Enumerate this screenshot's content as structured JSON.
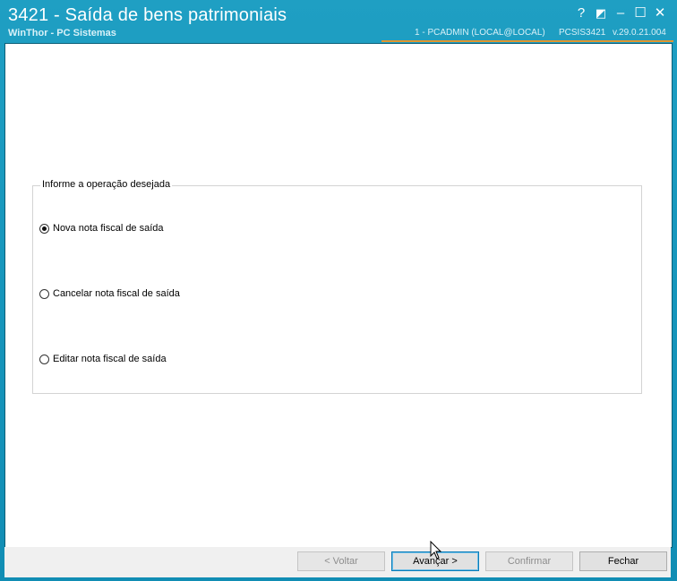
{
  "window": {
    "title": "3421 - Saída de bens patrimoniais",
    "subtitle": "WinThor - PC Sistemas",
    "status": {
      "user": "1 - PCADMIN (LOCAL@LOCAL)",
      "program": "PCSIS3421",
      "version": "v.29.0.21.004"
    },
    "controls": {
      "help": "?",
      "restore": "◩",
      "minimize": "–",
      "maximize": "☐",
      "close": "✕"
    }
  },
  "group": {
    "legend": "Informe a operação desejada",
    "options": [
      {
        "label": "Nova nota fiscal de saída",
        "selected": true
      },
      {
        "label": "Cancelar nota fiscal de saída",
        "selected": false
      },
      {
        "label": "Editar nota fiscal de saída",
        "selected": false
      }
    ]
  },
  "buttons": {
    "back": "< Voltar",
    "next": "Avançar >",
    "confirm": "Confirmar",
    "close": "Fechar"
  },
  "colors": {
    "titlebar": "#1797bd",
    "accent_line": "#e2962f"
  }
}
